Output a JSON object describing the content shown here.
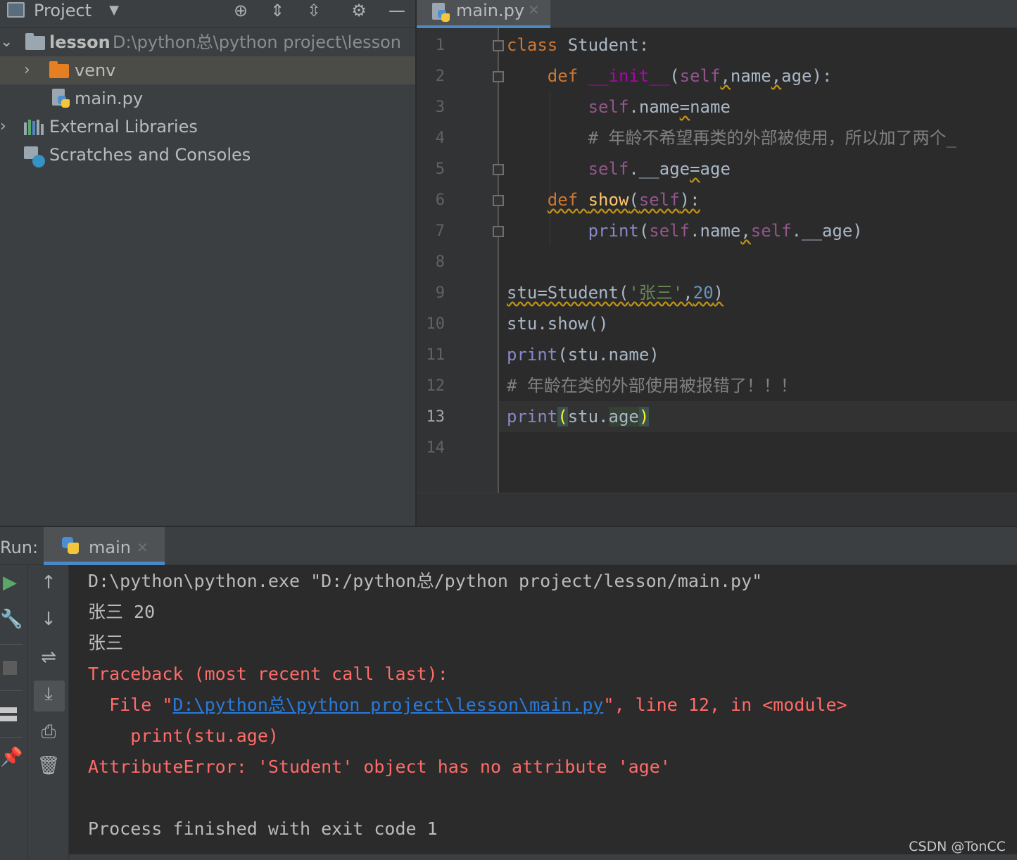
{
  "project_panel": {
    "title": "Project",
    "toolbar_icons": [
      "locate-icon",
      "expand-all-icon",
      "collapse-all-icon",
      "settings-icon",
      "hide-icon"
    ],
    "tree": [
      {
        "label": "lesson",
        "path": "D:\\python总\\python project\\lesson",
        "icon": "folder-icon",
        "expanded": true
      },
      {
        "label": "venv",
        "icon": "folder-icon",
        "color": "#e67e22",
        "selected": true
      },
      {
        "label": "main.py",
        "icon": "python-file-icon"
      },
      {
        "label": "External Libraries",
        "icon": "libraries-icon"
      },
      {
        "label": "Scratches and Consoles",
        "icon": "scratches-icon"
      }
    ]
  },
  "editor": {
    "tab_label": "main.py",
    "line_numbers": [
      "1",
      "2",
      "3",
      "4",
      "5",
      "6",
      "7",
      "8",
      "9",
      "10",
      "11",
      "12",
      "13",
      "14"
    ],
    "current_line": "13",
    "comment_line4": "# 年龄不希望再类的外部被使用，所以加了两个_",
    "comment_line12": "# 年龄在类的外部使用被报错了！！！",
    "string_literal": "'张三'",
    "number_literal": "20"
  },
  "run_panel": {
    "label": "Run:",
    "tab_label": "main",
    "console": {
      "cmd": "D:\\python\\python.exe \"D:/python总/python project/lesson/main.py\"",
      "out1": "张三 20",
      "out2": "张三",
      "tb_header": "Traceback (most recent call last):",
      "tb_file_prefix": "  File \"",
      "tb_file_link": "D:\\python总\\python project\\lesson\\main.py",
      "tb_file_suffix": "\", line 12, in <module>",
      "tb_code": "    print(stu.age)",
      "error": "AttributeError: 'Student' object has no attribute 'age'",
      "exit": "Process finished with exit code 1"
    }
  },
  "watermark": "CSDN @TonCC",
  "colors": {
    "accent": "#4a88c7",
    "error": "#ff6b68",
    "link": "#287bde",
    "keyword": "#cc7832",
    "self": "#94558d"
  }
}
